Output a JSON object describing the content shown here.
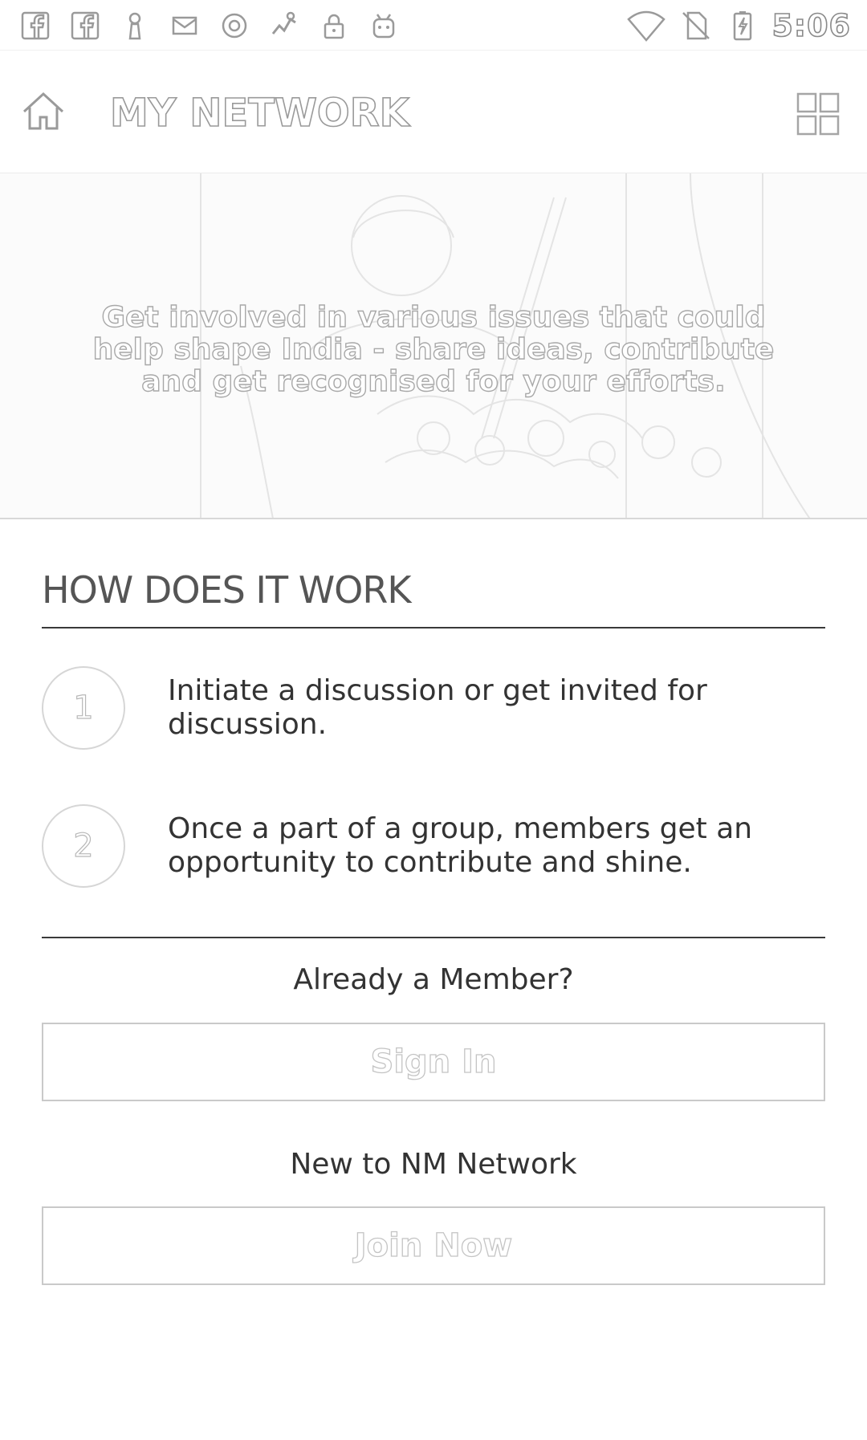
{
  "status_bar": {
    "time": "5:06",
    "left_icons": [
      "facebook-icon",
      "facebook-icon",
      "keyhole-person-icon",
      "mail-icon",
      "o-circle-icon",
      "fitness-tracker-icon",
      "lock-icon",
      "android-icon"
    ],
    "right_icons": [
      "wifi-icon",
      "no-sim-icon",
      "battery-charging-icon"
    ]
  },
  "app_bar": {
    "title": "MY NETWORK",
    "left_icon": "home-icon",
    "right_icon": "grid-menu-icon"
  },
  "hero": {
    "text": "Get involved in various issues that could help shape India - share ideas, contribute and get recognised for your efforts."
  },
  "how_it_works": {
    "title": "HOW DOES IT WORK",
    "steps": [
      {
        "number": "1",
        "text": "Initiate a discussion or get invited for discussion."
      },
      {
        "number": "2",
        "text": "Once a part of a group, members get an opportunity to contribute and shine."
      }
    ]
  },
  "member": {
    "already_prompt": "Already a Member?",
    "sign_in_label": "Sign In",
    "new_prompt": "New to NM Network",
    "join_label": "Join Now"
  },
  "colors": {
    "background": "#ffffff",
    "text": "#333333",
    "outline_text_stroke": "#9a9a9a",
    "rule": "#3a3a3a",
    "button_border": "#c9c9c9"
  }
}
